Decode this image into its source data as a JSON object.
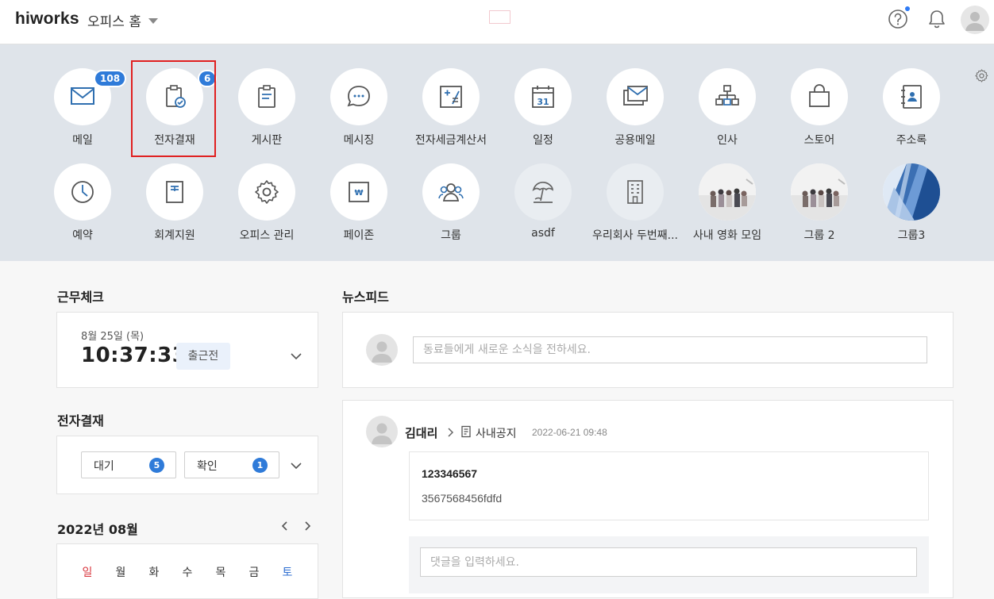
{
  "header": {
    "logo": "hiworks",
    "office_home": "오피스 홈"
  },
  "apps": [
    {
      "label": "메일",
      "icon": "mail-icon",
      "badge": "108"
    },
    {
      "label": "전자결재",
      "icon": "clipboard-check-icon",
      "badge": "6",
      "highlighted": true
    },
    {
      "label": "게시판",
      "icon": "board-icon",
      "badge": ""
    },
    {
      "label": "메시징",
      "icon": "chat-bubble-icon",
      "badge": ""
    },
    {
      "label": "전자세금계산서",
      "icon": "tax-invoice-icon",
      "badge": ""
    },
    {
      "label": "일정",
      "icon": "calendar-icon",
      "badge": "",
      "icon_text": "31"
    },
    {
      "label": "공용메일",
      "icon": "shared-mail-icon",
      "badge": ""
    },
    {
      "label": "인사",
      "icon": "org-chart-icon",
      "badge": ""
    },
    {
      "label": "스토어",
      "icon": "store-bag-icon",
      "badge": ""
    },
    {
      "label": "주소록",
      "icon": "address-book-icon",
      "badge": ""
    },
    {
      "label": "예약",
      "icon": "clock-icon",
      "badge": ""
    },
    {
      "label": "회계지원",
      "icon": "ledger-icon",
      "badge": ""
    },
    {
      "label": "오피스 관리",
      "icon": "gear-icon",
      "badge": ""
    },
    {
      "label": "페이존",
      "icon": "won-icon",
      "badge": "",
      "icon_text": "₩"
    },
    {
      "label": "그룹",
      "icon": "group-icon",
      "badge": ""
    },
    {
      "label": "asdf",
      "icon": "beach-umbrella-icon",
      "badge": ""
    },
    {
      "label": "우리회사 두번째...",
      "icon": "building-icon",
      "badge": ""
    },
    {
      "label": "사내 영화 모임",
      "icon": "photo-people-icon",
      "badge": ""
    },
    {
      "label": "그룹 2",
      "icon": "photo-people-icon",
      "badge": ""
    },
    {
      "label": "그룹3",
      "icon": "photo-glass-building-icon",
      "badge": ""
    }
  ],
  "attendance": {
    "title": "근무체크",
    "date": "8월 25일 (목)",
    "time": "10:37:33",
    "status": "출근전"
  },
  "approval": {
    "title": "전자결재",
    "waiting_label": "대기",
    "waiting_count": "5",
    "confirm_label": "확인",
    "confirm_count": "1"
  },
  "calendar": {
    "title": "2022년 08월",
    "weekdays": [
      "일",
      "월",
      "화",
      "수",
      "목",
      "금",
      "토"
    ]
  },
  "newsfeed": {
    "title": "뉴스피드",
    "compose_placeholder": "동료들에게 새로운 소식을 전하세요.",
    "post": {
      "author": "김대리",
      "board": "사내공지",
      "time": "2022-06-21 09:48",
      "title": "123346567",
      "body": "3567568456fdfd"
    },
    "comment_placeholder": "댓글을 입력하세요."
  },
  "colors": {
    "accent": "#2f7bd9",
    "highlight_border": "#e02020",
    "sunday": "#d9363e",
    "saturday": "#2f6fd1"
  }
}
